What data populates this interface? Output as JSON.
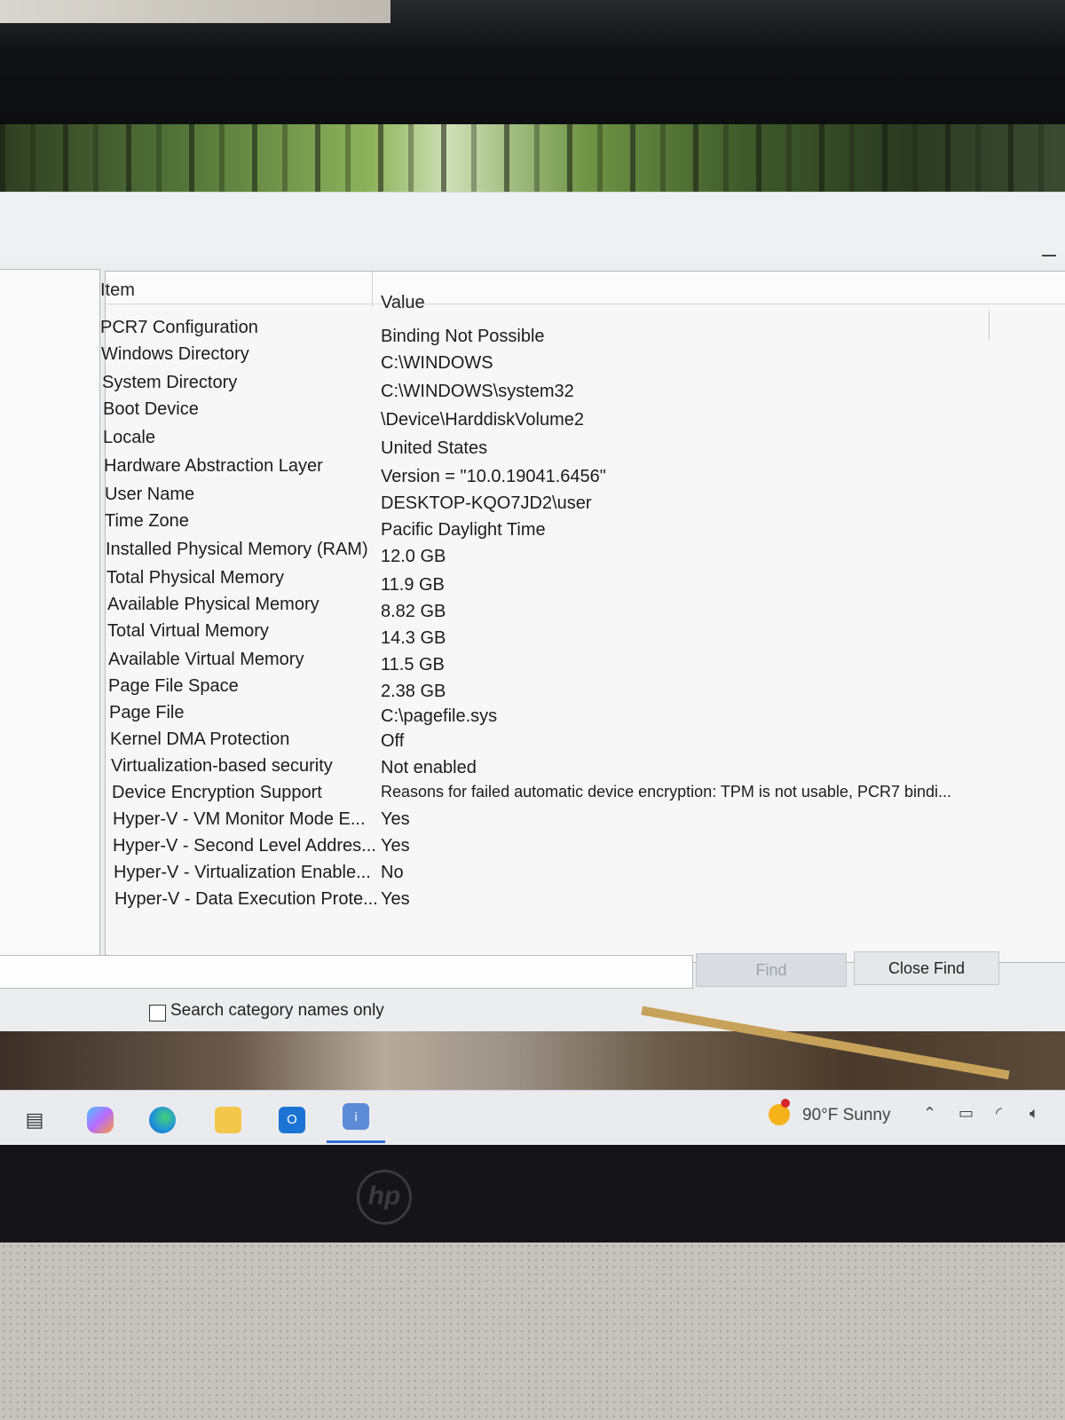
{
  "list": {
    "header_item": "Item",
    "header_value": "Value",
    "rows": [
      {
        "item": "PCR7 Configuration",
        "value": "Binding Not Possible"
      },
      {
        "item": "Windows Directory",
        "value": "C:\\WINDOWS"
      },
      {
        "item": "System Directory",
        "value": "C:\\WINDOWS\\system32"
      },
      {
        "item": "Boot Device",
        "value": "\\Device\\HarddiskVolume2"
      },
      {
        "item": "Locale",
        "value": "United States"
      },
      {
        "item": "Hardware Abstraction Layer",
        "value": "Version = \"10.0.19041.6456\""
      },
      {
        "item": "User Name",
        "value": "DESKTOP-KQO7JD2\\user"
      },
      {
        "item": "Time Zone",
        "value": "Pacific Daylight Time"
      },
      {
        "item": "Installed Physical Memory (RAM)",
        "value": "12.0 GB"
      },
      {
        "item": "Total Physical Memory",
        "value": "11.9 GB"
      },
      {
        "item": "Available Physical Memory",
        "value": "8.82 GB"
      },
      {
        "item": "Total Virtual Memory",
        "value": "14.3 GB"
      },
      {
        "item": "Available Virtual Memory",
        "value": "11.5 GB"
      },
      {
        "item": "Page File Space",
        "value": "2.38 GB"
      },
      {
        "item": "Page File",
        "value": "C:\\pagefile.sys"
      },
      {
        "item": "Kernel DMA Protection",
        "value": "Off"
      },
      {
        "item": "Virtualization-based security",
        "value": "Not enabled"
      },
      {
        "item": "Device Encryption Support",
        "value": "Reasons for failed automatic device encryption: TPM is not usable, PCR7 bindi..."
      },
      {
        "item": "Hyper-V - VM Monitor Mode E...",
        "value": "Yes"
      },
      {
        "item": "Hyper-V - Second Level Addres...",
        "value": "Yes"
      },
      {
        "item": "Hyper-V - Virtualization Enable...",
        "value": "No"
      },
      {
        "item": "Hyper-V - Data Execution Prote...",
        "value": "Yes"
      }
    ]
  },
  "find": {
    "input_value": "",
    "find_label": "Find",
    "close_find_label": "Close Find",
    "search_categories_label": "Search category names only"
  },
  "taskbar": {
    "weather": "90°F  Sunny",
    "icons": [
      "task-view-icon",
      "copilot-icon",
      "edge-icon",
      "file-explorer-icon",
      "outlook-icon",
      "system-information-icon"
    ]
  },
  "bezel": {
    "logo": "hp"
  },
  "colors": {
    "window_bg": "#ecedef",
    "accent": "#2f6fd1",
    "find_disabled_text": "#9ea2aa"
  }
}
